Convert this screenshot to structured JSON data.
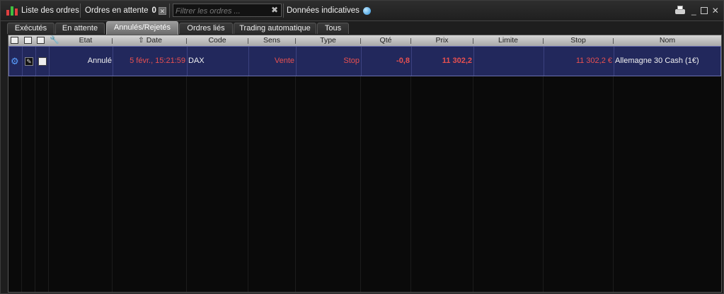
{
  "topbar": {
    "orders_list": "Liste des ordres",
    "pending_label": "Ordres en attente",
    "pending_count": "0",
    "filter_placeholder": "Filtrer les ordres ...",
    "indicative": "Données indicatives"
  },
  "tabs": [
    {
      "label": "Exécutés",
      "active": false
    },
    {
      "label": "En attente",
      "active": false
    },
    {
      "label": "Annulés/Rejetés",
      "active": true
    },
    {
      "label": "Ordres liés",
      "active": false
    },
    {
      "label": "Trading automatique",
      "active": false
    },
    {
      "label": "Tous",
      "active": false
    }
  ],
  "columns": {
    "etat": "Etat",
    "date": "Date",
    "code": "Code",
    "sens": "Sens",
    "type": "Type",
    "qte": "Qté",
    "prix": "Prix",
    "limite": "Limite",
    "stop": "Stop",
    "nom": "Nom"
  },
  "rows": [
    {
      "etat": "Annulé",
      "date": "5 févr., 15:21:59",
      "code": "DAX",
      "sens": "Vente",
      "type": "Stop",
      "qte": "-0,8",
      "prix": "11 302,2",
      "limite": "",
      "stop": "11 302,2 €",
      "nom": "Allemagne 30 Cash (1€)"
    }
  ],
  "colors": {
    "selected_row": "#22285c",
    "sell_red": "#e85050",
    "header_bg": "#c0c0c0"
  },
  "icons": [
    "candles-icon",
    "clear-filter-icon",
    "info-bubble-icon",
    "print-icon",
    "minimize-icon",
    "maximize-icon",
    "close-icon",
    "settings-gears-icon",
    "edit-icon",
    "document-icon",
    "wrench-icon",
    "sort-up-icon"
  ]
}
